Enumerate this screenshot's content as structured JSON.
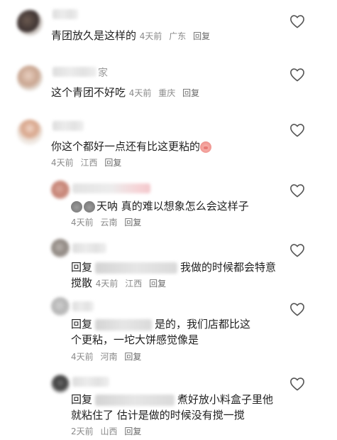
{
  "comments": [
    {
      "text": "青团放久是这样的",
      "time": "4天前",
      "location": "广东",
      "reply": "回复"
    },
    {
      "name_visible": "家",
      "text": "这个青团不好吃",
      "time": "4天前",
      "location": "重庆",
      "reply": "回复"
    },
    {
      "text": "你这个都好一点还有比这更粘的",
      "time": "4天前",
      "location": "江西",
      "reply": "回复",
      "replies": [
        {
          "text": "天呐 真的难以想象怎么会这样子",
          "time": "4天前",
          "location": "云南",
          "reply": "回复"
        },
        {
          "prefix": "回复",
          "text_line1": "我做的时候都会特意",
          "text_line2": "搅散",
          "time": "4天前",
          "location": "江西",
          "reply": "回复"
        },
        {
          "prefix": "回复",
          "text_line1": "是的，我们店都比这",
          "text_line2": "个更粘，一坨大饼感觉像是",
          "time": "4天前",
          "location": "河南",
          "reply": "回复"
        },
        {
          "prefix": "回复",
          "text_line1": "煮好放小料盒子里他",
          "text_line2": "就粘住了 估计是做的时候没有搅一搅",
          "time": "2天前",
          "location": "山西",
          "reply": "回复"
        }
      ]
    }
  ],
  "icons": {
    "like": "heart-outline-icon",
    "pig_emoji": "pig-face-emoji",
    "cat_emoji": "cat-face-emoji"
  },
  "colors": {
    "text": "#1f1f1f",
    "meta": "#8a8a8a",
    "heart": "#555555"
  }
}
